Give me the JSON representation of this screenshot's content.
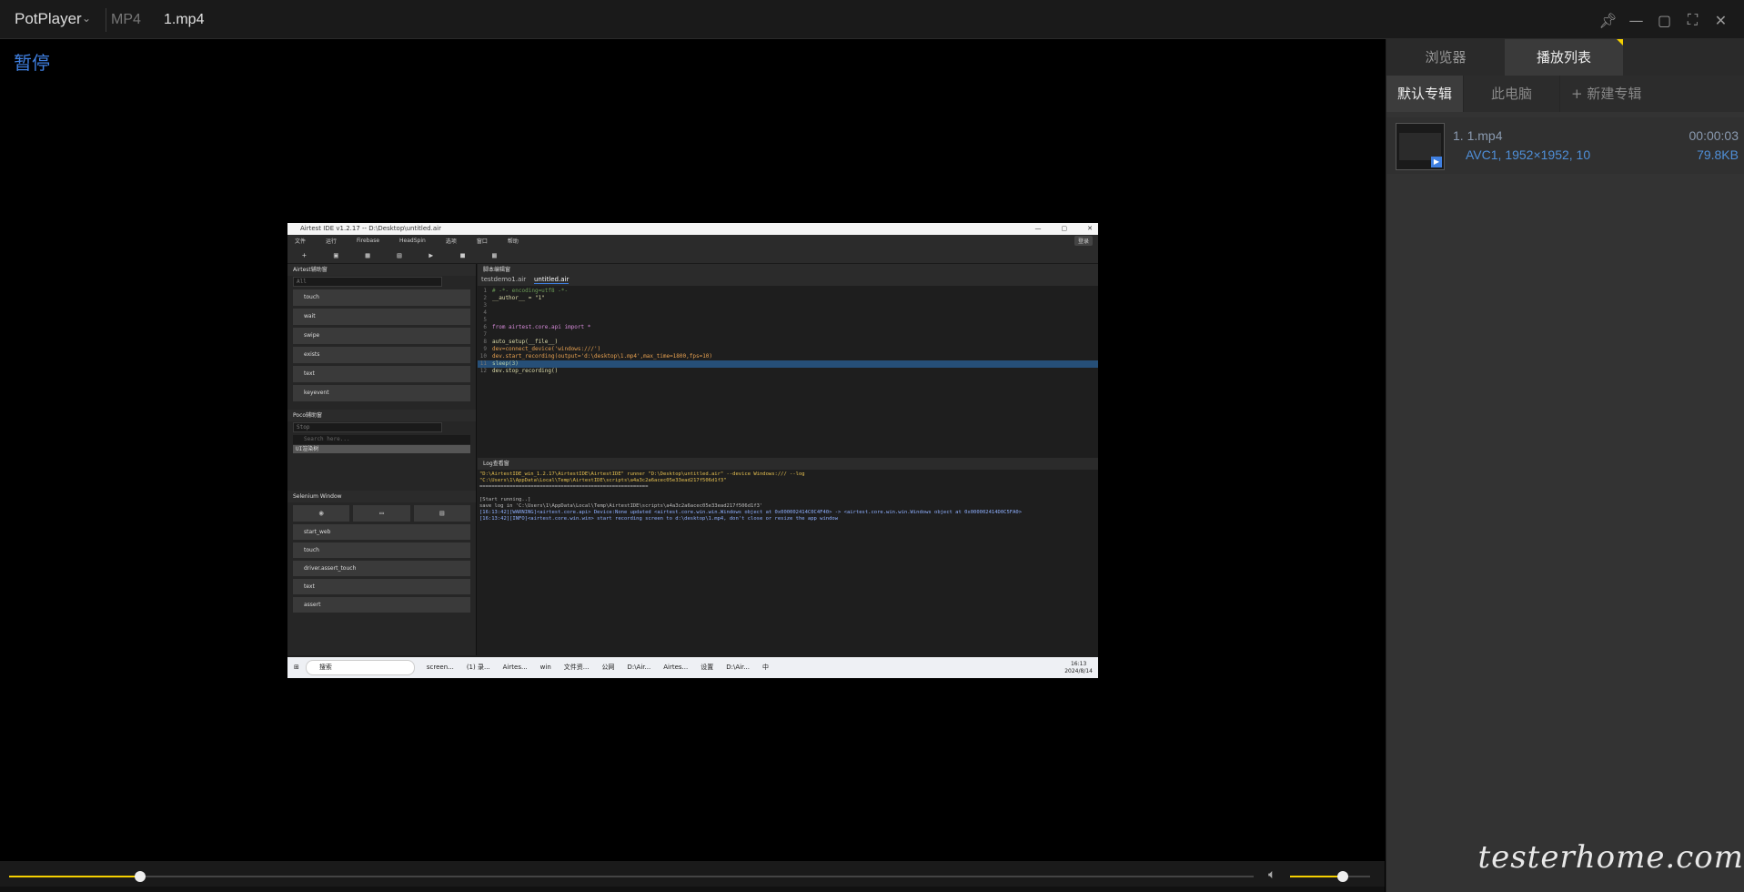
{
  "titlebar": {
    "brand": "PotPlayer",
    "format": "MP4",
    "filename": "1.mp4"
  },
  "osd": {
    "status": "暂停"
  },
  "embedded": {
    "window_title": "Airtest IDE v1.2.17 -- D:\\Desktop\\untitled.air",
    "login": "登录",
    "menu": [
      "文件",
      "运行",
      "Firebase",
      "HeadSpin",
      "选项",
      "窗口",
      "帮助"
    ],
    "airtest_panel": {
      "title": "Airtest辅助窗",
      "filter": "All",
      "items": [
        "touch",
        "wait",
        "swipe",
        "exists",
        "text",
        "keyevent"
      ]
    },
    "poco_panel": {
      "title": "Poco辅助窗",
      "mode": "Stop",
      "search_placeholder": "Search here...",
      "tree_root": "UI渲染树"
    },
    "selenium_panel": {
      "title": "Selenium Window",
      "items": [
        "start_web",
        "touch",
        "driver.assert_touch",
        "text",
        "assert"
      ]
    },
    "editor": {
      "title": "脚本编辑窗",
      "tabs": [
        "testdemo1.air",
        "untitled.air"
      ],
      "lines": [
        {
          "n": "1",
          "text": "# -*- encoding=utf8 -*-"
        },
        {
          "n": "2",
          "text": "__author__ = \"1\""
        },
        {
          "n": "3",
          "text": ""
        },
        {
          "n": "4",
          "text": ""
        },
        {
          "n": "5",
          "text": ""
        },
        {
          "n": "6",
          "text": "from airtest.core.api import *"
        },
        {
          "n": "7",
          "text": ""
        },
        {
          "n": "8",
          "text": "auto_setup(__file__)"
        },
        {
          "n": "9",
          "text": "dev=connect_device('windows:///')"
        },
        {
          "n": "10",
          "text": "dev.start_recording(output='d:\\desktop\\1.mp4',max_time=1800,fps=10)"
        },
        {
          "n": "11",
          "text": "sleep(3)"
        },
        {
          "n": "12",
          "text": "dev.stop_recording()"
        }
      ]
    },
    "log": {
      "title": "Log查看窗",
      "lines": [
        "\"D:\\AirtestIDE_win_1.2.17\\AirtestIDE\\AirtestIDE\" runner \"D:\\Desktop\\untitled.air\"   --device Windows:///   --log",
        "\"C:\\Users\\1\\AppData\\Local\\Temp\\AirtestIDE\\scripts\\a4a3c2a6acec05e33ead217f506d1f3\"",
        "========================================================",
        "",
        "[Start running..]",
        "save log in 'C:\\Users\\1\\AppData\\Local\\Temp\\AirtestIDE\\scripts\\a4a3c2a6acec05e33ead217f506d1f3'",
        "[16:13:42][WARNING]<airtest.core.api> Device:None updated <airtest.core.win.win.Windows object at 0x000002414C0C4F40> -> <airtest.core.win.win.Windows object at 0x000002414D0C5FA0>",
        "[16:13:42][INFO]<airtest.core.win.win> start recording screen to d:\\desktop\\1.mp4, don't close or resize the app window"
      ]
    },
    "taskbar": {
      "search": "搜索",
      "apps": [
        "screen...",
        "(1) 录...",
        "Airtes...",
        "win",
        "文件资...",
        "公网",
        "D:\\Air...",
        "Airtes...",
        "设置",
        "D:\\Air..."
      ],
      "tray": "中",
      "time": "16:13",
      "date": "2024/8/14"
    }
  },
  "sidebar": {
    "tabs": [
      "浏览器",
      "播放列表"
    ],
    "active_tab": "播放列表",
    "subtabs": [
      "默认专辑",
      "此电脑",
      "+ 新建专辑"
    ],
    "playlist": [
      {
        "name": "1. 1.mp4",
        "meta": "AVC1, 1952×1952, 10",
        "duration": "00:00:03",
        "size": "79.8KB"
      }
    ],
    "watermark": "testerhome.com"
  },
  "controls": {
    "seek_progress": 0.105,
    "volume": 0.66
  },
  "colors": {
    "accent": "#f5d000",
    "osd": "#3f7fe0",
    "highlight": "#264f78"
  }
}
